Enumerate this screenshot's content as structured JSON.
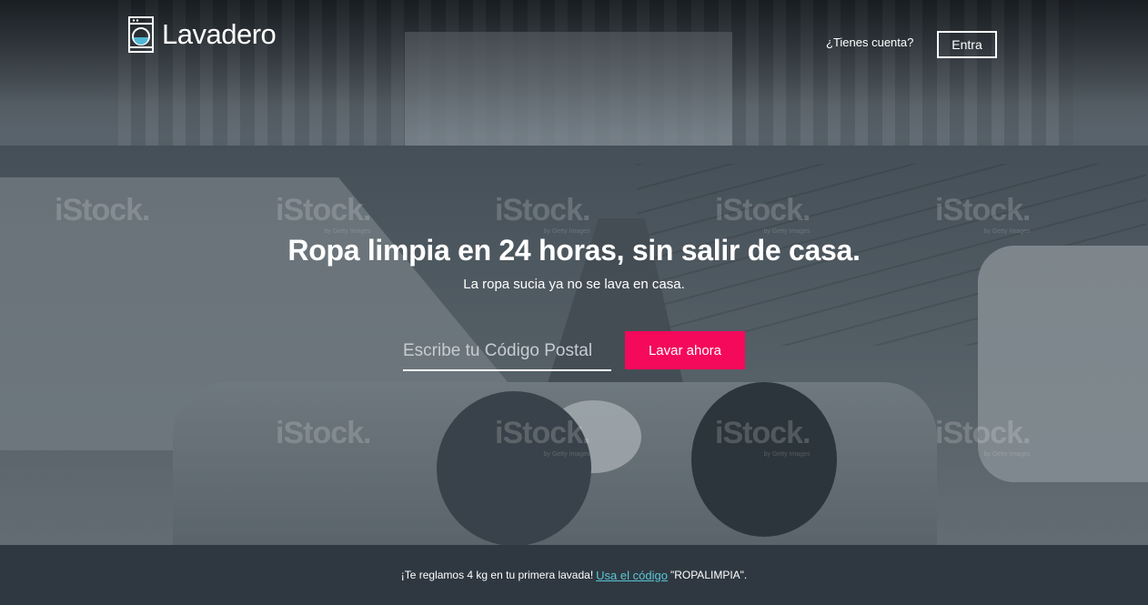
{
  "header": {
    "brand": "Lavadero",
    "account_question": "¿Tienes cuenta?",
    "login_label": "Entra"
  },
  "hero": {
    "headline": "Ropa limpia en 24 horas, sin salir de casa.",
    "subline": "La ropa sucia ya no se lava en casa.",
    "zip_placeholder": "Escribe tu Código Postal",
    "cta_label": "Lavar ahora",
    "watermark": {
      "brand": "iStock.",
      "byline": "by Getty Images"
    }
  },
  "promo": {
    "text_before": "¡Te reglamos 4 kg en tu primera lavada!",
    "link_text": "Usa el código",
    "code": "\"ROPALIMPIA\"."
  },
  "colors": {
    "accent": "#f4095b",
    "link": "#5bc6d6",
    "footer_bg": "#2f3841"
  }
}
